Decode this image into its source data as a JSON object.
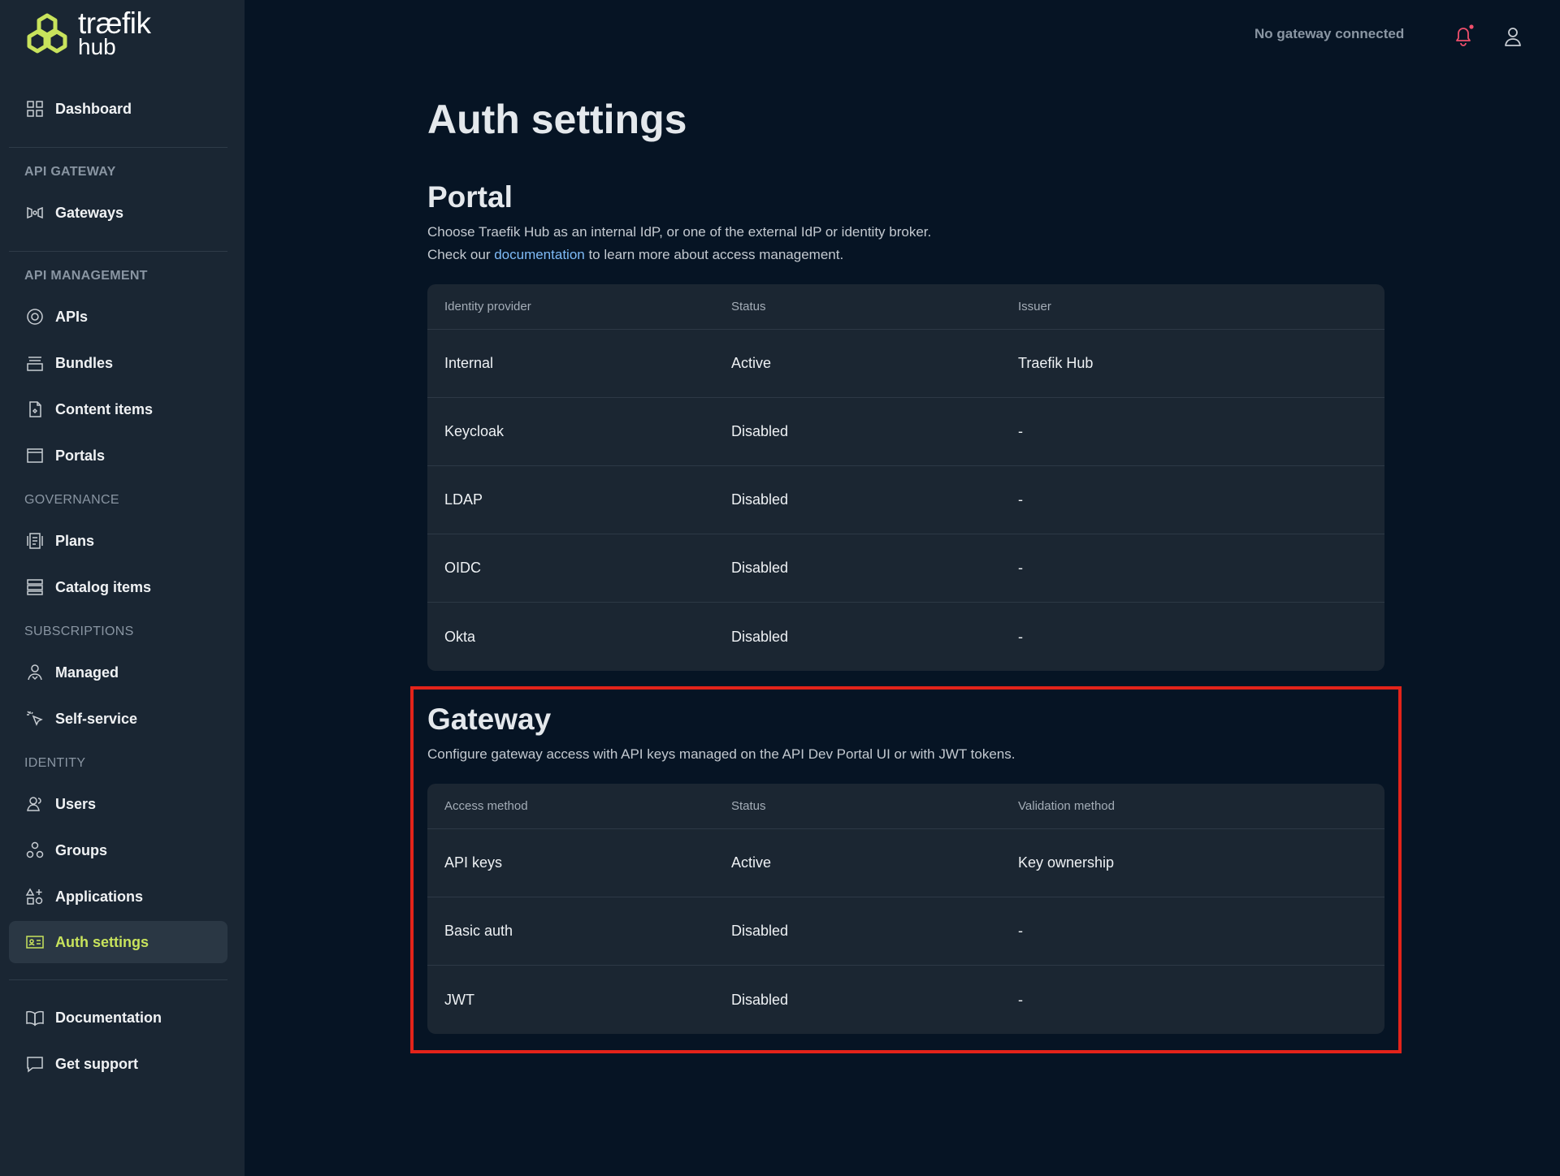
{
  "brand": {
    "line1": "træfik",
    "line2": "hub",
    "logo_color": "#c8e35c"
  },
  "header": {
    "gateway_status": "No gateway connected",
    "notification_dot_color": "#f04f6c"
  },
  "sidebar": {
    "dashboard": "Dashboard",
    "sections": {
      "api_gateway": "API GATEWAY",
      "api_management": "API MANAGEMENT",
      "governance": "GOVERNANCE",
      "subscriptions": "SUBSCRIPTIONS",
      "identity": "IDENTITY"
    },
    "items": {
      "gateways": "Gateways",
      "apis": "APIs",
      "bundles": "Bundles",
      "content_items": "Content items",
      "portals": "Portals",
      "plans": "Plans",
      "catalog_items": "Catalog items",
      "managed": "Managed",
      "self_service": "Self-service",
      "users": "Users",
      "groups": "Groups",
      "applications": "Applications",
      "auth_settings": "Auth settings",
      "documentation": "Documentation",
      "get_support": "Get support"
    },
    "active_item": "auth_settings"
  },
  "main": {
    "title": "Auth settings",
    "portal": {
      "title": "Portal",
      "desc_line1": "Choose Traefik Hub as an internal IdP, or one of the external IdP or identity broker.",
      "desc_line2_pre": "Check our ",
      "desc_link": "documentation",
      "desc_line2_post": " to learn more about access management.",
      "columns": [
        "Identity provider",
        "Status",
        "Issuer"
      ],
      "rows": [
        [
          "Internal",
          "Active",
          "Traefik Hub"
        ],
        [
          "Keycloak",
          "Disabled",
          "-"
        ],
        [
          "LDAP",
          "Disabled",
          "-"
        ],
        [
          "OIDC",
          "Disabled",
          "-"
        ],
        [
          "Okta",
          "Disabled",
          "-"
        ]
      ]
    },
    "gateway": {
      "title": "Gateway",
      "desc": "Configure gateway access with API keys managed on the API Dev Portal UI or with JWT tokens.",
      "columns": [
        "Access method",
        "Status",
        "Validation method"
      ],
      "rows": [
        [
          "API keys",
          "Active",
          "Key ownership"
        ],
        [
          "Basic auth",
          "Disabled",
          "-"
        ],
        [
          "JWT",
          "Disabled",
          "-"
        ]
      ]
    }
  }
}
